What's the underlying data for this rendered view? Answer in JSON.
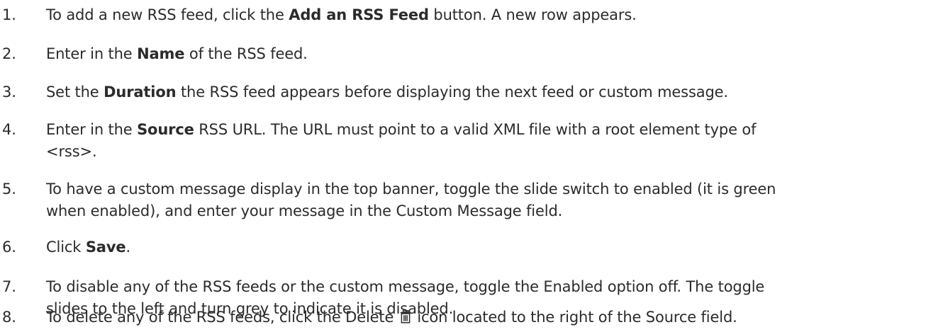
{
  "steps": [
    {
      "num": "1.",
      "parts": [
        {
          "text": "To add a new RSS feed, click the "
        },
        {
          "text": "Add an RSS Feed",
          "bold": true
        },
        {
          "text": " button. A new row appears."
        }
      ]
    },
    {
      "num": "2.",
      "parts": [
        {
          "text": "Enter in the "
        },
        {
          "text": "Name",
          "bold": true
        },
        {
          "text": " of the RSS feed."
        }
      ]
    },
    {
      "num": "3.",
      "parts": [
        {
          "text": "Set the "
        },
        {
          "text": "Duration",
          "bold": true
        },
        {
          "text": " the RSS feed appears before displaying the next feed or custom message."
        }
      ]
    },
    {
      "num": "4.",
      "parts": [
        {
          "text": "Enter in the "
        },
        {
          "text": "Source",
          "bold": true
        },
        {
          "text": " RSS URL. The URL must point to a valid XML file with a root element type of\n<rss>."
        }
      ]
    },
    {
      "num": "5.",
      "parts": [
        {
          "text": "To have a custom message display in the top banner, toggle the slide switch to enabled (it is green\nwhen enabled), and enter your message in the Custom Message field."
        }
      ]
    },
    {
      "num": "6.",
      "parts": [
        {
          "text": "Click "
        },
        {
          "text": "Save",
          "bold": true
        },
        {
          "text": "."
        }
      ]
    },
    {
      "num": "7.",
      "parts": [
        {
          "text": "To disable any of the RSS feeds or the custom message, toggle the Enabled option off. The toggle\nslides to the left and turn grey to indicate it is disabled."
        }
      ]
    },
    {
      "num": "8.",
      "parts": [
        {
          "text": "To delete any of the RSS feeds, click the Delete "
        },
        {
          "icon": "trash-icon"
        },
        {
          "text": " icon located to the right of the Source field."
        }
      ]
    }
  ]
}
